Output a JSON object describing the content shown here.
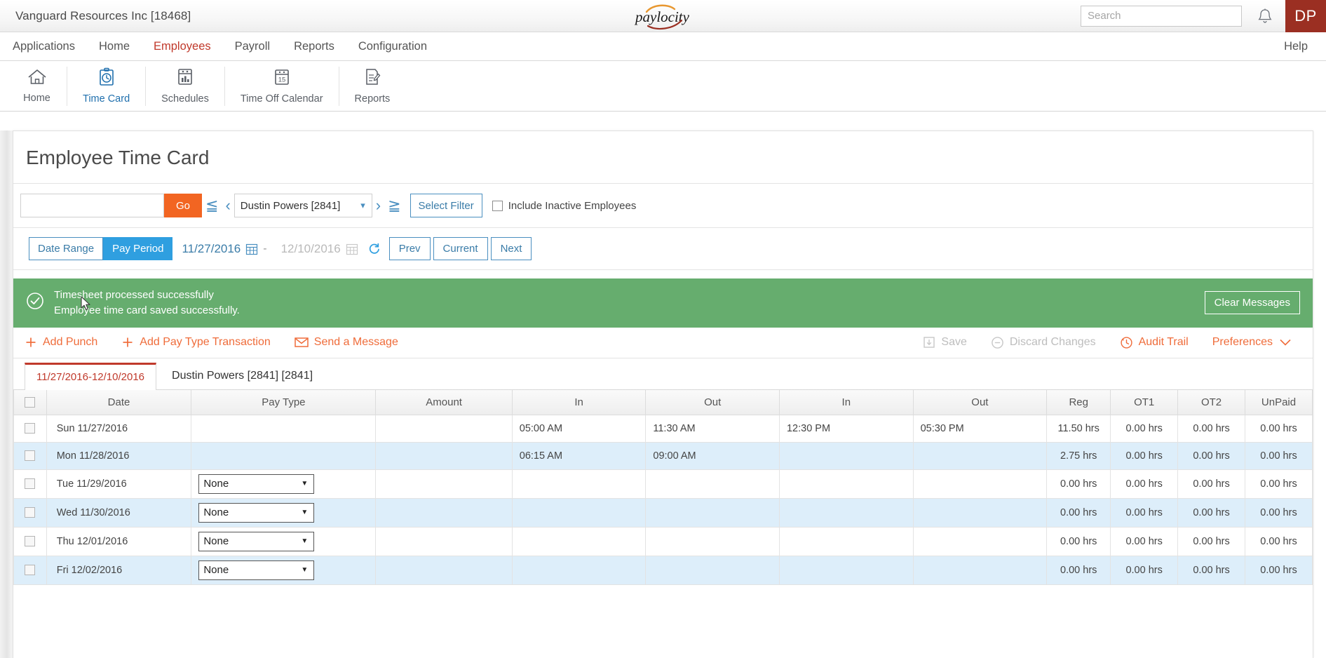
{
  "topbar": {
    "company": "Vanguard Resources Inc [18468]",
    "logo_text": "paylocity",
    "search_placeholder": "Search",
    "avatar_initials": "DP"
  },
  "mainnav": {
    "items": [
      {
        "label": "Applications",
        "active": false
      },
      {
        "label": "Home",
        "active": false
      },
      {
        "label": "Employees",
        "active": true
      },
      {
        "label": "Payroll",
        "active": false
      },
      {
        "label": "Reports",
        "active": false
      },
      {
        "label": "Configuration",
        "active": false
      }
    ],
    "help": "Help"
  },
  "icontoolbar": {
    "items": [
      {
        "label": "Home",
        "icon": "home-icon",
        "active": false
      },
      {
        "label": "Time Card",
        "icon": "time-card-icon",
        "active": true
      },
      {
        "label": "Schedules",
        "icon": "schedules-icon",
        "active": false
      },
      {
        "label": "Time Off Calendar",
        "icon": "calendar-15-icon",
        "active": false
      },
      {
        "label": "Reports",
        "icon": "reports-icon",
        "active": false
      }
    ]
  },
  "page": {
    "title": "Employee Time Card"
  },
  "employee_row": {
    "search_value": "",
    "go_label": "Go",
    "selected_employee": "Dustin Powers [2841]",
    "select_filter_label": "Select Filter",
    "include_inactive_label": "Include Inactive Employees",
    "include_inactive_checked": false
  },
  "date_row": {
    "date_range_label": "Date Range",
    "pay_period_label": "Pay Period",
    "active_mode": "Pay Period",
    "start_date": "11/27/2016",
    "end_date": "12/10/2016",
    "separator": "-",
    "prev_label": "Prev",
    "current_label": "Current",
    "next_label": "Next"
  },
  "alert": {
    "line1": "Timesheet processed successfully",
    "line2": "Employee time card saved successfully.",
    "clear_label": "Clear Messages",
    "color": "#66ad6e"
  },
  "actions": {
    "add_punch": "Add Punch",
    "add_pay_type": "Add Pay Type Transaction",
    "send_message": "Send a Message",
    "save": "Save",
    "discard": "Discard Changes",
    "audit_trail": "Audit Trail",
    "preferences": "Preferences"
  },
  "tabs": {
    "period_tab": "11/27/2016-12/10/2016",
    "employee_label": "Dustin Powers [2841] [2841]"
  },
  "table": {
    "headers": [
      "",
      "Date",
      "Pay Type",
      "Amount",
      "In",
      "Out",
      "In",
      "Out",
      "Reg",
      "OT1",
      "OT2",
      "UnPaid"
    ],
    "rows": [
      {
        "date": "Sun 11/27/2016",
        "pay_type": "",
        "amount": "",
        "in1": "05:00 AM",
        "out1": "11:30 AM",
        "in2": "12:30 PM",
        "out2": "05:30 PM",
        "reg": "11.50 hrs",
        "ot1": "0.00 hrs",
        "ot2": "0.00 hrs",
        "unpaid": "0.00 hrs"
      },
      {
        "date": "Mon 11/28/2016",
        "pay_type": "",
        "amount": "",
        "in1": "06:15 AM",
        "out1": "09:00 AM",
        "in2": "",
        "out2": "",
        "reg": "2.75 hrs",
        "ot1": "0.00 hrs",
        "ot2": "0.00 hrs",
        "unpaid": "0.00 hrs"
      },
      {
        "date": "Tue 11/29/2016",
        "pay_type": "None",
        "amount": "",
        "in1": "",
        "out1": "",
        "in2": "",
        "out2": "",
        "reg": "0.00 hrs",
        "ot1": "0.00 hrs",
        "ot2": "0.00 hrs",
        "unpaid": "0.00 hrs"
      },
      {
        "date": "Wed 11/30/2016",
        "pay_type": "None",
        "amount": "",
        "in1": "",
        "out1": "",
        "in2": "",
        "out2": "",
        "reg": "0.00 hrs",
        "ot1": "0.00 hrs",
        "ot2": "0.00 hrs",
        "unpaid": "0.00 hrs"
      },
      {
        "date": "Thu 12/01/2016",
        "pay_type": "None",
        "amount": "",
        "in1": "",
        "out1": "",
        "in2": "",
        "out2": "",
        "reg": "0.00 hrs",
        "ot1": "0.00 hrs",
        "ot2": "0.00 hrs",
        "unpaid": "0.00 hrs"
      },
      {
        "date": "Fri 12/02/2016",
        "pay_type": "None",
        "amount": "",
        "in1": "",
        "out1": "",
        "in2": "",
        "out2": "",
        "reg": "0.00 hrs",
        "ot1": "0.00 hrs",
        "ot2": "0.00 hrs",
        "unpaid": "0.00 hrs"
      }
    ]
  },
  "colors": {
    "accent_orange": "#f26522",
    "link_orange": "#ef6c3a",
    "brand_red": "#c0392b",
    "avatar_red": "#9b2f22",
    "blue": "#2f9fe0",
    "green": "#66ad6e"
  }
}
